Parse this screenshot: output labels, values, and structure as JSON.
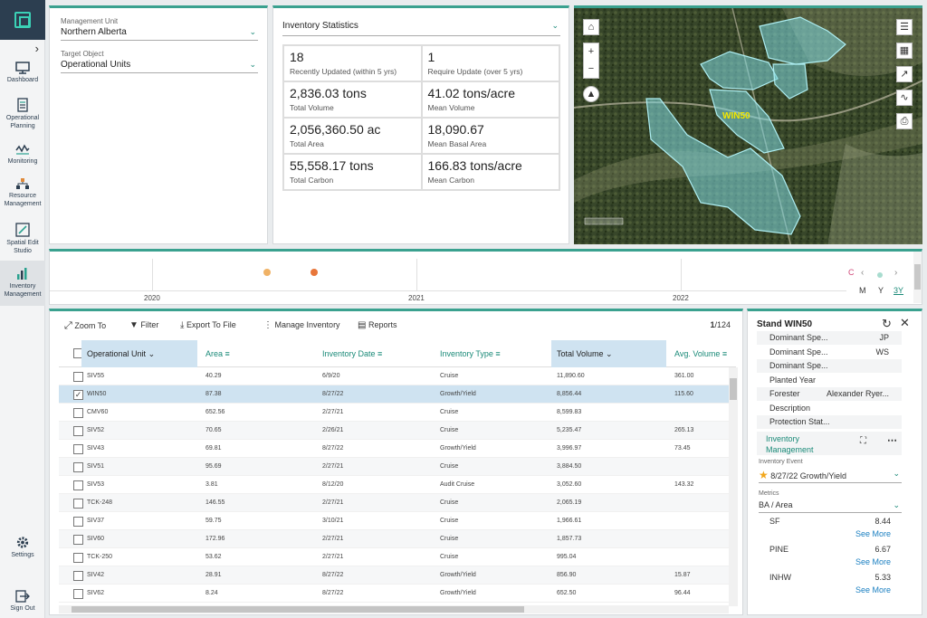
{
  "sidebar": {
    "items": [
      {
        "label": "Dashboard"
      },
      {
        "label": "Operational Planning"
      },
      {
        "label": "Monitoring"
      },
      {
        "label": "Resource Management"
      },
      {
        "label": "Spatial Edit Studio"
      },
      {
        "label": "Inventory Management"
      },
      {
        "label": "Settings"
      },
      {
        "label": "Sign Out"
      }
    ],
    "expand_icon": "chevron-right-icon"
  },
  "filters": {
    "management_unit_label": "Management Unit",
    "management_unit_value": "Northern Alberta",
    "target_object_label": "Target Object",
    "target_object_value": "Operational Units"
  },
  "stats": {
    "title": "Inventory Statistics",
    "cells": [
      {
        "value": "18",
        "label": "Recently Updated (within 5 yrs)"
      },
      {
        "value": "1",
        "label": "Require Update (over 5 yrs)"
      },
      {
        "value": "2,836.03 tons",
        "label": "Total Volume"
      },
      {
        "value": "41.02 tons/acre",
        "label": "Mean Volume"
      },
      {
        "value": "2,056,360.50 ac",
        "label": "Total Area"
      },
      {
        "value": "18,090.67",
        "label": "Mean Basal Area"
      },
      {
        "value": "55,558.17 tons",
        "label": "Total Carbon"
      },
      {
        "value": "166.83 tons/acre",
        "label": "Mean Carbon"
      }
    ]
  },
  "map": {
    "stand_label": "WIN50",
    "polygon_color": "#7fd9e0"
  },
  "timeline": {
    "years": [
      "2020",
      "2021",
      "2022"
    ],
    "zoom": [
      "M",
      "Y",
      "3Y"
    ],
    "selected_zoom": "3Y",
    "reset_label": "C",
    "dot_colors": [
      "#f0b266",
      "#e8763a"
    ]
  },
  "toolbar": {
    "zoom_to": "Zoom To",
    "filter": "Filter",
    "export": "Export To File",
    "manage": "Manage Inventory",
    "reports": "Reports",
    "page_current": "1",
    "page_total": "/124"
  },
  "table": {
    "headers": [
      "Operational Unit",
      "Area",
      "Inventory Date",
      "Inventory Type",
      "Total Volume",
      "Avg. Volume"
    ],
    "rows": [
      [
        "SIV55",
        "40.29",
        "6/9/20",
        "Cruise",
        "11,890.60",
        "361.00"
      ],
      [
        "WIN50",
        "87.38",
        "8/27/22",
        "Growth/Yield",
        "8,856.44",
        "115.60"
      ],
      [
        "CMV60",
        "652.56",
        "2/27/21",
        "Cruise",
        "8,599.83",
        ""
      ],
      [
        "SIV52",
        "70.65",
        "2/26/21",
        "Cruise",
        "5,235.47",
        "265.13"
      ],
      [
        "SIV43",
        "69.81",
        "8/27/22",
        "Growth/Yield",
        "3,996.97",
        "73.45"
      ],
      [
        "SIV51",
        "95.69",
        "2/27/21",
        "Cruise",
        "3,884.50",
        ""
      ],
      [
        "SIV53",
        "3.81",
        "8/12/20",
        "Audit Cruise",
        "3,052.60",
        "143.32"
      ],
      [
        "TCK-248",
        "146.55",
        "2/27/21",
        "Cruise",
        "2,065.19",
        ""
      ],
      [
        "SIV37",
        "59.75",
        "3/10/21",
        "Cruise",
        "1,966.61",
        ""
      ],
      [
        "SIV60",
        "172.96",
        "2/27/21",
        "Cruise",
        "1,857.73",
        ""
      ],
      [
        "TCK-250",
        "53.62",
        "2/27/21",
        "Cruise",
        "995.04",
        ""
      ],
      [
        "SIV42",
        "28.91",
        "8/27/22",
        "Growth/Yield",
        "856.90",
        "15.87"
      ],
      [
        "SIV62",
        "8.24",
        "8/27/22",
        "Growth/Yield",
        "652.50",
        "96.44"
      ]
    ],
    "selected_index": 1
  },
  "detail": {
    "title": "Stand WIN50",
    "fields": [
      {
        "key": "Dominant Spe...",
        "value": "JP"
      },
      {
        "key": "Dominant Spe...",
        "value": "WS"
      },
      {
        "key": "Dominant Spe...",
        "value": ""
      },
      {
        "key": "Planted Year",
        "value": ""
      },
      {
        "key": "Forester",
        "value": "Alexander Ryer..."
      },
      {
        "key": "Description",
        "value": ""
      },
      {
        "key": "Protection Stat...",
        "value": ""
      }
    ],
    "section": "Inventory Management",
    "event_label": "Inventory Event",
    "event_value": "8/27/22 Growth/Yield",
    "metrics_label": "Metrics",
    "metrics_value": "BA / Area",
    "metrics": [
      {
        "name": "SF",
        "value": "8.44"
      },
      {
        "name": "PINE",
        "value": "6.67"
      },
      {
        "name": "INHW",
        "value": "5.33"
      }
    ],
    "see_more": "See More"
  }
}
